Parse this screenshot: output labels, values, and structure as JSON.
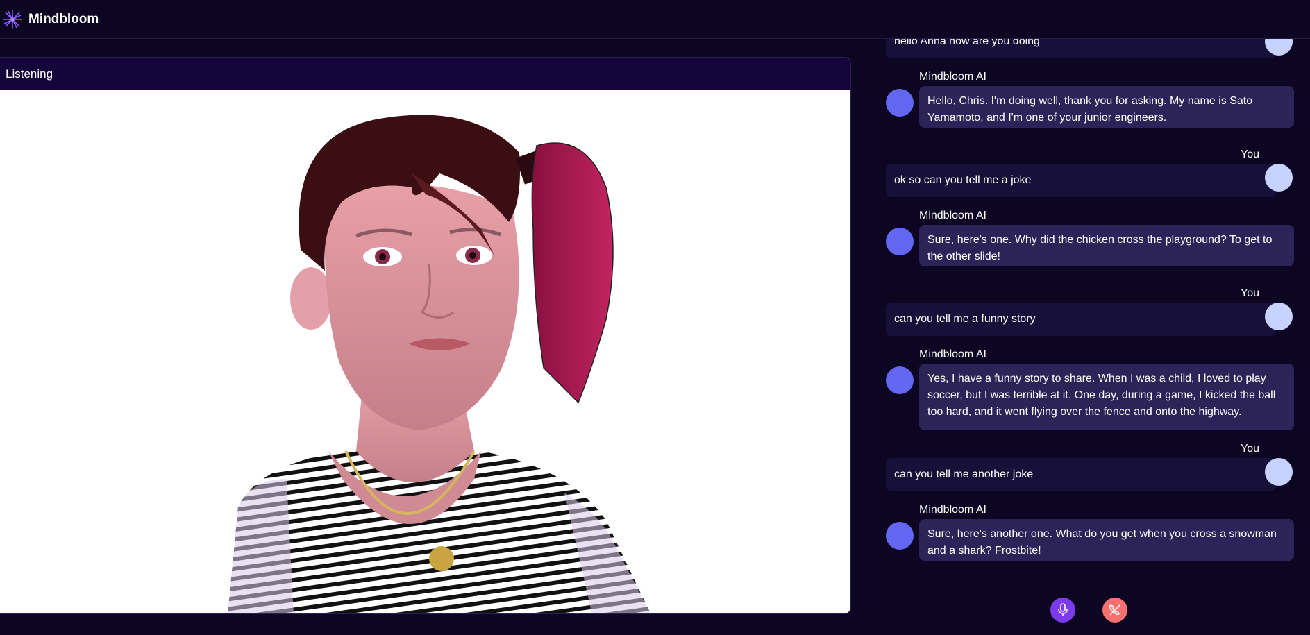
{
  "app": {
    "brand": "Mindbloom",
    "logo_icon": "sparkle-flower-icon",
    "accent": "#7c3aed"
  },
  "video": {
    "status": "Listening"
  },
  "chat": {
    "messages": [
      {
        "role": "user",
        "sender": "",
        "text": "hello Anna how are you doing"
      },
      {
        "role": "ai",
        "sender": "Mindbloom AI",
        "lines": [
          "Hello, Chris. I'm doing well, thank you for asking. My name is Sato",
          "Yamamoto, and I'm one of your junior engineers."
        ]
      },
      {
        "role": "user",
        "sender": "You",
        "text": "ok so can you tell me a joke"
      },
      {
        "role": "ai",
        "sender": "Mindbloom AI",
        "lines": [
          "Sure, here's one. Why did the chicken cross the playground? To get to",
          "the other slide!"
        ]
      },
      {
        "role": "user",
        "sender": "You",
        "text": "can you tell me a funny story"
      },
      {
        "role": "ai",
        "sender": "Mindbloom AI",
        "lines": [
          "Yes, I have a funny story to share. When I was a child, I loved to play",
          "soccer, but I was terrible at it. One day, during a game, I kicked the ball",
          "too hard, and it went flying over the fence and onto the highway."
        ]
      },
      {
        "role": "user",
        "sender": "You",
        "text": "can you tell me another joke"
      },
      {
        "role": "ai",
        "sender": "Mindbloom AI",
        "lines": [
          "Sure, here's another one. What do you get when you cross a snowman",
          "and a shark? Frostbite!"
        ]
      }
    ]
  },
  "controls": {
    "mic_icon": "microphone-icon",
    "mic_color": "#7c3aed",
    "end_call_icon": "phone-hangup-icon",
    "end_call_color": "#f87171"
  }
}
